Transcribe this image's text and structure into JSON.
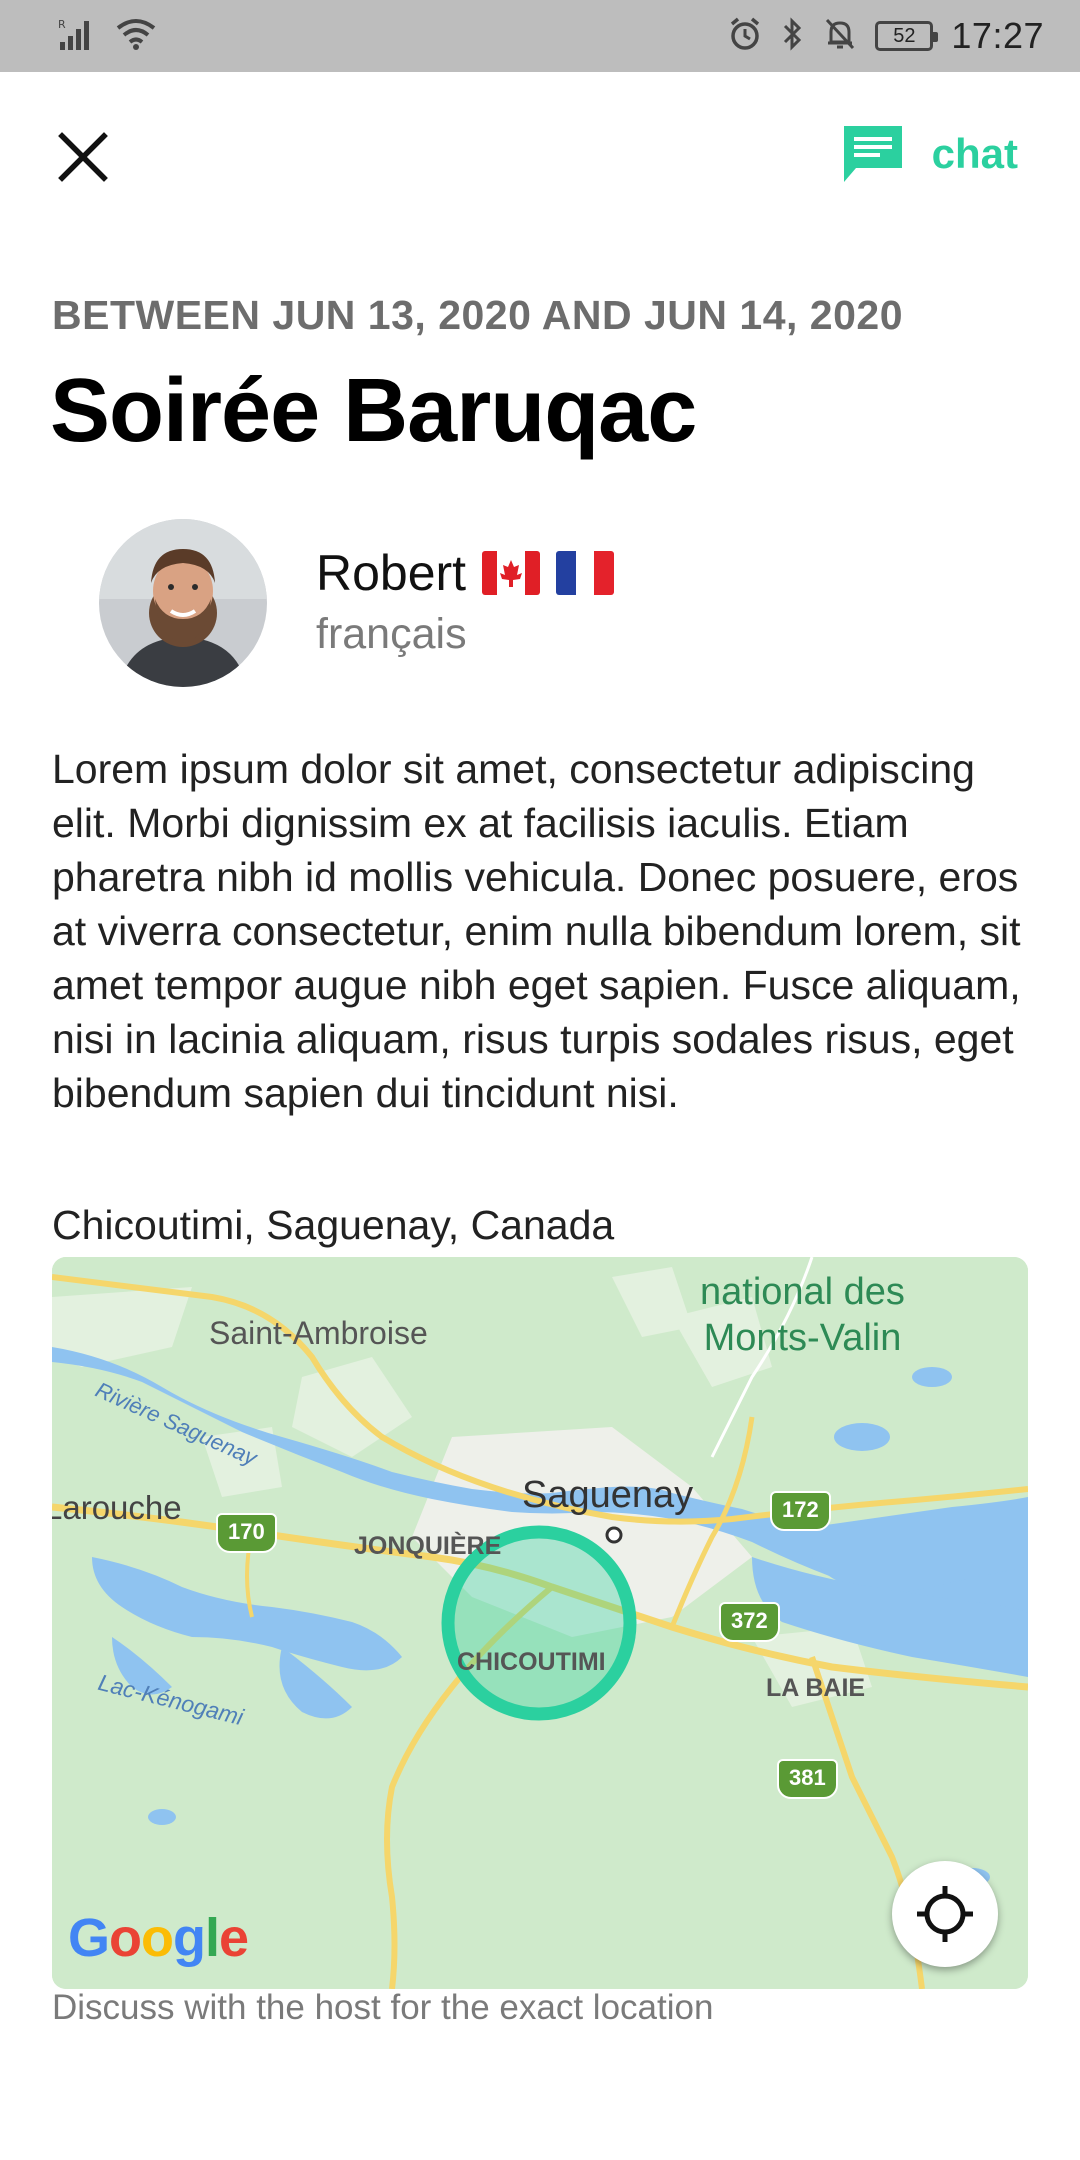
{
  "status_bar": {
    "time": "17:27",
    "battery_level": "52",
    "icons": [
      "signal-icon",
      "wifi-icon",
      "alarm-icon",
      "bluetooth-icon",
      "mute-icon",
      "battery-icon"
    ]
  },
  "header": {
    "close_icon": "close-icon",
    "chat_label": "chat",
    "chat_icon": "chat-bubble-icon"
  },
  "event": {
    "date_range": "BETWEEN JUN 13, 2020 AND JUN 14, 2020",
    "title": "Soirée Baruqac",
    "description": "Lorem ipsum dolor sit amet, consectetur adipiscing elit. Morbi dignissim ex at facilisis iaculis. Etiam pharetra nibh id mollis vehicula. Donec posuere, eros at viverra consectetur, enim nulla bibendum lorem, sit amet tempor augue nibh eget sapien. Fusce aliquam, nisi in lacinia aliquam, risus turpis sodales risus, eget bibendum sapien dui tincidunt nisi.",
    "location": "Chicoutimi, Saguenay, Canada",
    "map_note": "Discuss with the host for the exact location"
  },
  "host": {
    "name": "Robert",
    "language": "français",
    "flags": [
      "canada-flag",
      "france-flag"
    ]
  },
  "map": {
    "labels": {
      "park": "national des\nMonts-Valin",
      "saint_ambroise": "Saint-Ambroise",
      "riviere": "Rivière Saguenay",
      "larouche": "Larouche",
      "saguenay": "Saguenay",
      "jonquiere": "JONQUIÈRE",
      "chicoutimi": "CHICOUTIMI",
      "la_baie": "LA BAIE",
      "lac": "Lac-Kénogami"
    },
    "routes": [
      "170",
      "172",
      "372",
      "381"
    ],
    "logo": "Google",
    "colors": {
      "land": "#cfeacb",
      "water": "#8fc3f0",
      "road": "#f5d66b",
      "accent": "#2bd09f"
    }
  },
  "colors": {
    "accent": "#2bd09f",
    "status_bar": "#bdbdbd"
  }
}
